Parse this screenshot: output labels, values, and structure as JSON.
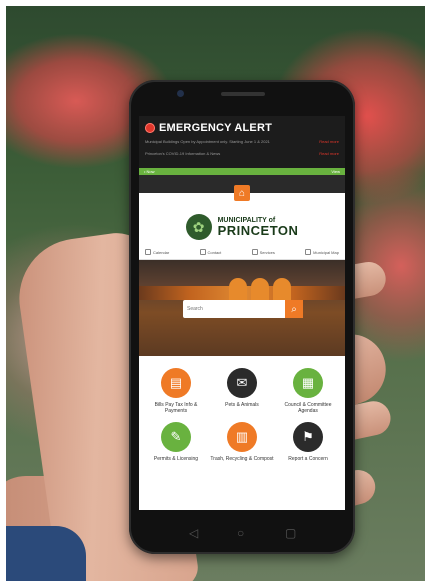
{
  "alert": {
    "title": "EMERGENCY ALERT",
    "line1": "Municipal Buildings Open by Appointment only. Starting June 1 & 2021",
    "line1_more": "Read more",
    "line2": "Princeton's COVID-19 Information & News",
    "line2_more": "Read more",
    "status_bar_left": "• Now",
    "status_bar_right": "View"
  },
  "home_icon": "home-icon",
  "logo": {
    "line1": "MUNICIPALITY of",
    "line2": "PRINCETON"
  },
  "tabs": [
    {
      "label": "Calendar",
      "icon": "calendar-icon"
    },
    {
      "label": "Contact",
      "icon": "contact-icon"
    },
    {
      "label": "Services",
      "icon": "services-icon"
    },
    {
      "label": "Municipal Map",
      "icon": "map-icon"
    }
  ],
  "search": {
    "placeholder": "Search"
  },
  "tiles": [
    {
      "label": "Bills Pay Tax Info & Payments",
      "color": "#ef7a26",
      "icon": "bill-icon"
    },
    {
      "label": "Pets & Animals",
      "color": "#2b2b2b",
      "icon": "pet-icon"
    },
    {
      "label": "Council & Committee Agendas",
      "color": "#69b23f",
      "icon": "agenda-icon"
    },
    {
      "label": "Permits & Licensing",
      "color": "#69b23f",
      "icon": "permit-icon"
    },
    {
      "label": "Trash, Recycling & Compost",
      "color": "#ef7a26",
      "icon": "trash-icon"
    },
    {
      "label": "Report a Concern",
      "color": "#2b2b2b",
      "icon": "report-icon"
    }
  ],
  "colors": {
    "accent_orange": "#ef7a26",
    "accent_green": "#69b23f",
    "alert_red": "#e0362b"
  }
}
